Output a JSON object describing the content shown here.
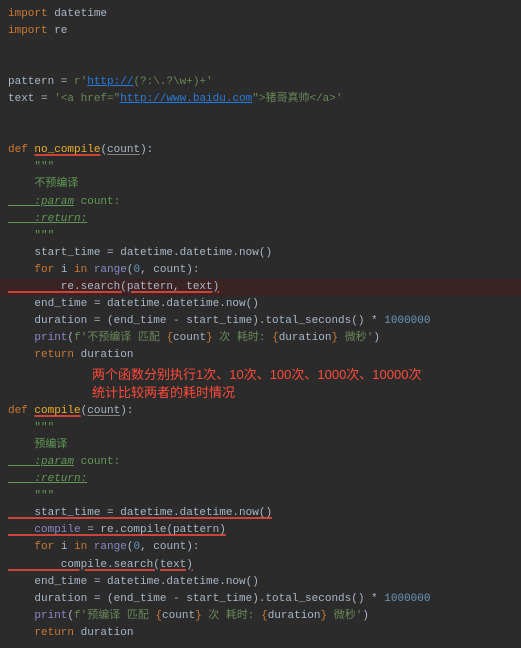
{
  "code": {
    "l1": "import",
    "l1b": " datetime",
    "l2": "import",
    "l2b": " re",
    "l4a": "pattern = ",
    "l4b": "r'",
    "l4u": "http://",
    "l4c": "(?:\\.?\\w+)+",
    "l4d": "'",
    "l5a": "text = ",
    "l5b": "'<a href=\"",
    "l5u": "http://www.baidu.com",
    "l5c": "\">猪哥真帅</a>'",
    "def": "def",
    "fn1": "no_compile",
    "open_paren": "(",
    "param_count": "count",
    "close_sig": "):",
    "triple": "    \"\"\"",
    "doc_no": "    不预编译",
    "doc_param": "    :param",
    "doc_param2": " count:",
    "doc_return": "    :return:",
    "st_a": "    start_time = datetime.datetime.now()",
    "for": "    for",
    "for_i": " i ",
    "in": "in",
    "range": " range",
    "range_args": "(",
    "zero": "0",
    "comma": ", count):",
    "re_search": "        re.search(pattern, text)",
    "end_a": "    end_time = datetime.datetime.now()",
    "dur_a": "    duration = (end_time - start_time).total_seconds() * ",
    "million": "1000000",
    "print": "    print",
    "fstr1": "(",
    "fstr1a": "f'不预编译 匹配 ",
    "fb": "{",
    "count_var": "count",
    "fb2": "}",
    "fstr1b": " 次 耗时: ",
    "dur_var": "duration",
    "fstr1c": " 微秒'",
    "close_p": ")",
    "return": "    return",
    "ret_val": " duration",
    "fn2": "compile",
    "doc_pre": "    预编译",
    "compile_line_a": "    compile",
    "compile_line_b": " = re.compile(pattern)",
    "compile_search": "        compile.search(text)",
    "fstr2a": "f'预编译 匹配 "
  },
  "annotation": {
    "line1": "两个函数分别执行1次、10次、100次、1000次、10000次",
    "line2": "统计比较两者的耗时情况"
  }
}
